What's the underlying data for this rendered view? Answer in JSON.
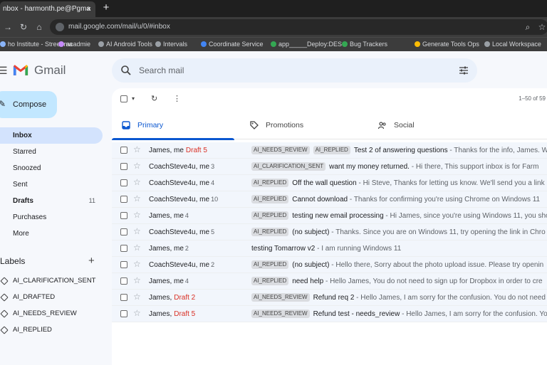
{
  "browser": {
    "tab_title": "nbox - harmonth.pe@Pgma",
    "tab_close": "×",
    "new_tab": "+",
    "url": "mail.google.com/mail/u/0/#inbox",
    "bookmarks": [
      {
        "label": "ho Institute - Street ma",
        "color": "#8ab4f8"
      },
      {
        "label": "acadmie",
        "color": "#c58af9"
      },
      {
        "label": "AI Android Tools",
        "color": "#9aa0a6"
      },
      {
        "label": "Intervals",
        "color": "#9aa0a6"
      },
      {
        "label": "Coordinate Service",
        "color": "#4285f4"
      },
      {
        "label": "app_____Deploy:DES",
        "color": "#34a853"
      },
      {
        "label": "Bug Trackers",
        "color": "#34a853"
      },
      {
        "label": "Generate Tools Ops",
        "color": "#fbbc04"
      },
      {
        "label": "Local Workspace",
        "color": "#9aa0a6"
      }
    ]
  },
  "app": {
    "name": "Gmail",
    "search_placeholder": "Search mail",
    "compose": "Compose",
    "pager": "1–50 of 59"
  },
  "nav": [
    {
      "label": "Inbox",
      "count": "",
      "active": true
    },
    {
      "label": "Starred",
      "count": ""
    },
    {
      "label": "Snoozed",
      "count": ""
    },
    {
      "label": "Sent",
      "count": ""
    },
    {
      "label": "Drafts",
      "count": "11"
    },
    {
      "label": "Purchases",
      "count": ""
    },
    {
      "label": "More",
      "count": ""
    }
  ],
  "labels": {
    "title": "Labels",
    "add": "+",
    "items": [
      "AI_CLARIFICATION_SENT",
      "AI_DRAFTED",
      "AI_NEEDS_REVIEW",
      "AI_REPLIED"
    ]
  },
  "tabs": [
    {
      "label": "Primary",
      "icon": "inbox-icon"
    },
    {
      "label": "Promotions",
      "icon": "tag-icon"
    },
    {
      "label": "Social",
      "icon": "people-icon"
    }
  ],
  "emails": [
    {
      "sender": "James, me",
      "count": "",
      "draft": "Draft 5",
      "badges": [
        "AI_NEEDS_REVIEW",
        "AI_REPLIED"
      ],
      "subject": "Test 2 of answering questions",
      "snippet": "Thanks for the info, James. W"
    },
    {
      "sender": "CoachSteve4u, me",
      "count": "3",
      "draft": "",
      "badges": [
        "AI_CLARIFICATION_SENT"
      ],
      "subject": "want my money returned.",
      "snippet": "Hi there, This support inbox is for Farm"
    },
    {
      "sender": "CoachSteve4u, me",
      "count": "4",
      "draft": "",
      "badges": [
        "AI_REPLIED"
      ],
      "subject": "Off the wall question",
      "snippet": "Hi Steve, Thanks for letting us know. We'll send you a link"
    },
    {
      "sender": "CoachSteve4u, me",
      "count": "10",
      "draft": "",
      "badges": [
        "AI_REPLIED"
      ],
      "subject": "Cannot download",
      "snippet": "Thanks for confirming you're using Chrome on Windows 11"
    },
    {
      "sender": "James, me",
      "count": "4",
      "draft": "",
      "badges": [
        "AI_REPLIED"
      ],
      "subject": "testing new email processing",
      "snippet": "Hi James, since you're using Windows 11, you sho"
    },
    {
      "sender": "CoachSteve4u, me",
      "count": "5",
      "draft": "",
      "badges": [
        "AI_REPLIED"
      ],
      "subject": "(no subject)",
      "snippet": "Thanks. Since you are on Windows 11, try opening the link in Chro"
    },
    {
      "sender": "James, me",
      "count": "2",
      "draft": "",
      "badges": [],
      "subject": "testing Tomarrow v2",
      "snippet": "I am running Windows 11"
    },
    {
      "sender": "CoachSteve4u, me",
      "count": "2",
      "draft": "",
      "badges": [
        "AI_REPLIED"
      ],
      "subject": "(no subject)",
      "snippet": "Hello there, Sorry about the photo upload issue. Please try openin"
    },
    {
      "sender": "James, me",
      "count": "4",
      "draft": "",
      "badges": [
        "AI_REPLIED"
      ],
      "subject": "need help",
      "snippet": "Hello James, You do not need to sign up for Dropbox in order to cre"
    },
    {
      "sender": "James,",
      "count": "",
      "draft": "Draft 2",
      "badges": [
        "AI_NEEDS_REVIEW"
      ],
      "subject": "Refund req 2",
      "snippet": "Hello James, I am sorry for the confusion. You do not need"
    },
    {
      "sender": "James,",
      "count": "",
      "draft": "Draft 5",
      "badges": [
        "AI_NEEDS_REVIEW"
      ],
      "subject": "Refund test - needs_review",
      "snippet": "Hello James, I am sorry for the confusion. You"
    }
  ],
  "colors": {
    "accent": "#0b57d0",
    "compose": "#c2e7ff",
    "active_nav": "#d3e3fd",
    "draft": "#d93025"
  }
}
